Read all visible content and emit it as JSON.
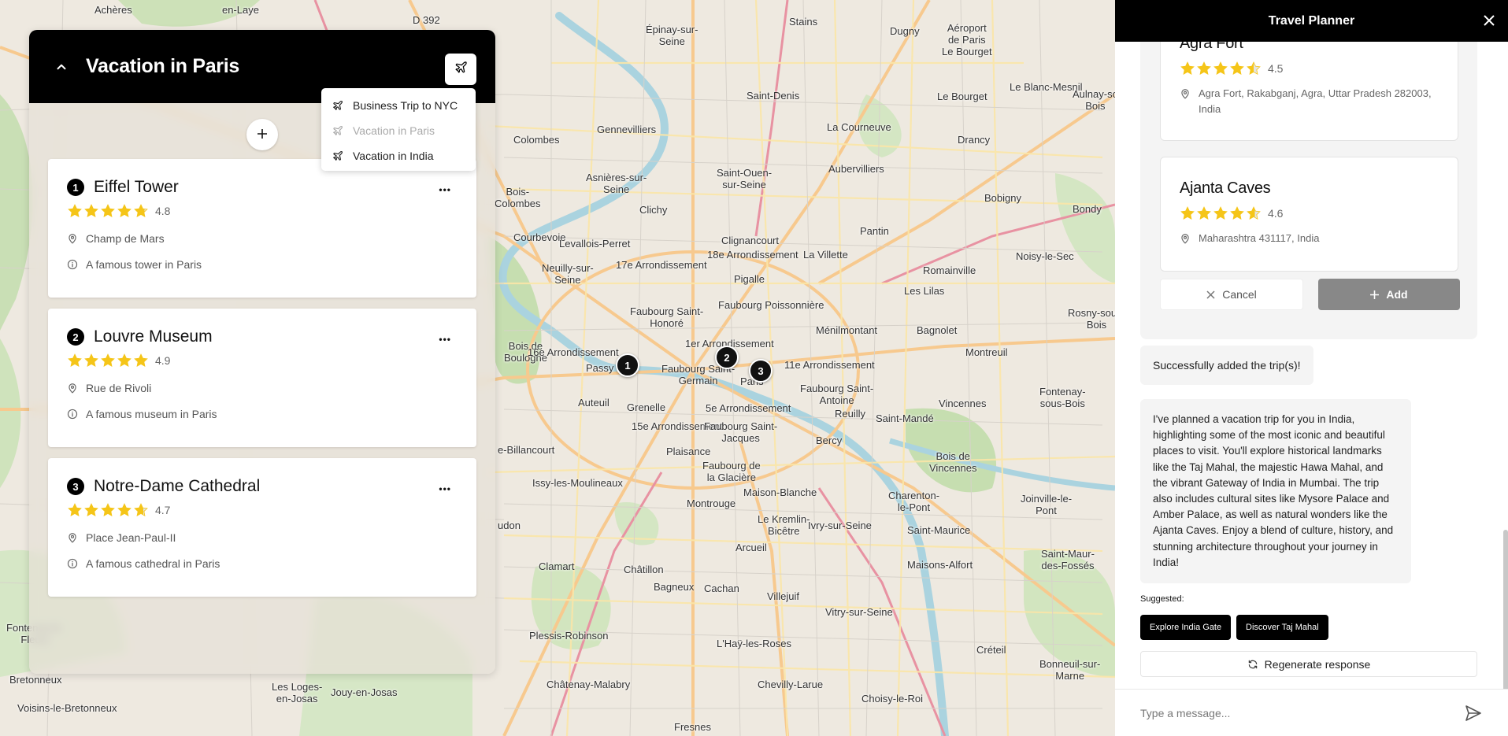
{
  "map": {
    "labels": [
      {
        "text": "Achères",
        "l": 120,
        "t": 5
      },
      {
        "text": "en-Laye",
        "l": 282,
        "t": 5
      },
      {
        "text": "D 392",
        "l": 524,
        "t": 18
      },
      {
        "text": "Épinay-sur-\nSeine",
        "l": 820,
        "t": 30
      },
      {
        "text": "Stains",
        "l": 1002,
        "t": 20
      },
      {
        "text": "Dugny",
        "l": 1130,
        "t": 32
      },
      {
        "text": "Aéroport\nde Paris\nLe Bourget",
        "l": 1196,
        "t": 28
      },
      {
        "text": "Gennevilliers",
        "l": 758,
        "t": 157
      },
      {
        "text": "Saint-Denis",
        "l": 948,
        "t": 114
      },
      {
        "text": "Le Bourget",
        "l": 1190,
        "t": 115
      },
      {
        "text": "Le Blanc-Mesnil",
        "l": 1282,
        "t": 103
      },
      {
        "text": "Aulnay-so\nBois",
        "l": 1362,
        "t": 112
      },
      {
        "text": "La Courneuve",
        "l": 1050,
        "t": 154
      },
      {
        "text": "Colombes",
        "l": 652,
        "t": 170
      },
      {
        "text": "Drancy",
        "l": 1216,
        "t": 170
      },
      {
        "text": "Asnières-sur-\nSeine",
        "l": 744,
        "t": 218
      },
      {
        "text": "Saint-Ouen-\nsur-Seine",
        "l": 910,
        "t": 212
      },
      {
        "text": "Aubervilliers",
        "l": 1052,
        "t": 207
      },
      {
        "text": "Bobigny",
        "l": 1250,
        "t": 244
      },
      {
        "text": "Bondy",
        "l": 1362,
        "t": 258
      },
      {
        "text": "Bois-\nColombes",
        "l": 628,
        "t": 236
      },
      {
        "text": "Clichy",
        "l": 812,
        "t": 259
      },
      {
        "text": "Courbevoie",
        "l": 652,
        "t": 294
      },
      {
        "text": "Levallois-Perret",
        "l": 710,
        "t": 302
      },
      {
        "text": "Clignancourt",
        "l": 916,
        "t": 298
      },
      {
        "text": "Pantin",
        "l": 1092,
        "t": 286
      },
      {
        "text": "Neuilly-sur-\nSeine",
        "l": 688,
        "t": 333
      },
      {
        "text": "17e Arrondissement",
        "l": 782,
        "t": 329
      },
      {
        "text": "18e Arrondissement",
        "l": 898,
        "t": 316
      },
      {
        "text": "La Villette",
        "l": 1020,
        "t": 316
      },
      {
        "text": "Noisy-le-Sec",
        "l": 1290,
        "t": 318
      },
      {
        "text": "Romainville",
        "l": 1172,
        "t": 336
      },
      {
        "text": "Pigalle",
        "l": 932,
        "t": 347
      },
      {
        "text": "Les Lilas",
        "l": 1148,
        "t": 362
      },
      {
        "text": "Faubourg Saint-\nHonoré",
        "l": 800,
        "t": 388
      },
      {
        "text": "Faubourg Poissonnière",
        "l": 912,
        "t": 380
      },
      {
        "text": "Rosny-sous-\nBois",
        "l": 1356,
        "t": 390
      },
      {
        "text": "Ménilmontant",
        "l": 1036,
        "t": 412
      },
      {
        "text": "Bagnolet",
        "l": 1164,
        "t": 412
      },
      {
        "text": "Bois de\nBoulogne",
        "l": 640,
        "t": 432
      },
      {
        "text": "16e Arrondissement",
        "l": 670,
        "t": 440
      },
      {
        "text": "1er Arrondissement",
        "l": 870,
        "t": 429
      },
      {
        "text": "Montreuil",
        "l": 1226,
        "t": 440
      },
      {
        "text": "Passy",
        "l": 744,
        "t": 460
      },
      {
        "text": "Faubourg Saint-\nGermain",
        "l": 840,
        "t": 461
      },
      {
        "text": "Paris",
        "l": 940,
        "t": 477
      },
      {
        "text": "11e Arrondissement",
        "l": 996,
        "t": 456
      },
      {
        "text": "Faubourg Saint-\nAntoine",
        "l": 1016,
        "t": 486
      },
      {
        "text": "Vincennes",
        "l": 1192,
        "t": 505
      },
      {
        "text": "Fontenay-\nsous-Bois",
        "l": 1320,
        "t": 490
      },
      {
        "text": "Auteuil",
        "l": 734,
        "t": 504
      },
      {
        "text": "Grenelle",
        "l": 796,
        "t": 510
      },
      {
        "text": "5e Arrondissement",
        "l": 896,
        "t": 511
      },
      {
        "text": "Reuilly",
        "l": 1060,
        "t": 518
      },
      {
        "text": "Saint-Mandé",
        "l": 1112,
        "t": 524
      },
      {
        "text": "15e Arrondissement",
        "l": 802,
        "t": 534
      },
      {
        "text": "Faubourg Saint-\nJacques",
        "l": 894,
        "t": 534
      },
      {
        "text": "Bercy",
        "l": 1036,
        "t": 552
      },
      {
        "text": "Bois de\nVincennes",
        "l": 1180,
        "t": 572
      },
      {
        "text": "e-Billancourt",
        "l": 632,
        "t": 564
      },
      {
        "text": "Plaisance",
        "l": 846,
        "t": 566
      },
      {
        "text": "Faubourg de\nla Glacière",
        "l": 892,
        "t": 584
      },
      {
        "text": "Issy-les-Moulineaux",
        "l": 676,
        "t": 606
      },
      {
        "text": "Maison-Blanche",
        "l": 944,
        "t": 618
      },
      {
        "text": "Charenton-\nle-Pont",
        "l": 1128,
        "t": 622
      },
      {
        "text": "Joinville-le-\nPont",
        "l": 1296,
        "t": 626
      },
      {
        "text": "Montrouge",
        "l": 872,
        "t": 632
      },
      {
        "text": "Le Kremlin-\nBicêtre",
        "l": 962,
        "t": 652
      },
      {
        "text": "Ivry-sur-Seine",
        "l": 1026,
        "t": 660
      },
      {
        "text": "Saint-Maurice",
        "l": 1152,
        "t": 666
      },
      {
        "text": "udon",
        "l": 632,
        "t": 660
      },
      {
        "text": "Arcueil",
        "l": 934,
        "t": 688
      },
      {
        "text": "Clamart",
        "l": 684,
        "t": 712
      },
      {
        "text": "Châtillon",
        "l": 792,
        "t": 716
      },
      {
        "text": "Maisons-Alfort",
        "l": 1152,
        "t": 710
      },
      {
        "text": "Saint-Maur-\ndes-Fossés",
        "l": 1322,
        "t": 696
      },
      {
        "text": "Bagneux",
        "l": 830,
        "t": 738
      },
      {
        "text": "Cachan",
        "l": 894,
        "t": 740
      },
      {
        "text": "Villejuif",
        "l": 974,
        "t": 750
      },
      {
        "text": "Vitry-sur-Seine",
        "l": 1048,
        "t": 770
      },
      {
        "text": "Plessis-Robinson",
        "l": 672,
        "t": 800
      },
      {
        "text": "L'Haÿ-les-Roses",
        "l": 910,
        "t": 810
      },
      {
        "text": "Créteil",
        "l": 1240,
        "t": 818
      },
      {
        "text": "Châtenay-Malabry",
        "l": 694,
        "t": 862
      },
      {
        "text": "Chevilly-Larue",
        "l": 962,
        "t": 862
      },
      {
        "text": "Choisy-le-Roi",
        "l": 1094,
        "t": 880
      },
      {
        "text": "Bonneuil-sur-\nMarne",
        "l": 1320,
        "t": 836
      },
      {
        "text": "Fresnes",
        "l": 856,
        "t": 916
      },
      {
        "text": "Jouy-en-Josas",
        "l": 420,
        "t": 872
      },
      {
        "text": "Les Loges-\nen-Josas",
        "l": 345,
        "t": 865
      },
      {
        "text": "Bretonneux",
        "l": 12,
        "t": 856
      },
      {
        "text": "Voisins-le-Bretonneux",
        "l": 22,
        "t": 892
      },
      {
        "text": "Fontenay-le-\nFleury",
        "l": 8,
        "t": 790
      }
    ],
    "markers": [
      {
        "label": "1",
        "l": 782,
        "t": 449
      },
      {
        "label": "2",
        "l": 908,
        "t": 439
      },
      {
        "label": "3",
        "l": 951,
        "t": 456
      }
    ]
  },
  "trip_panel": {
    "title": "Vacation in Paris",
    "collapse_icon": "chevron-up-icon",
    "switch_icon": "plane-icon",
    "add_icon": "plus-icon",
    "places": [
      {
        "num": "1",
        "name": "Eiffel Tower",
        "rating": 4.8,
        "rating_text": "4.8",
        "address": "Champ de Mars",
        "description": "A famous tower in Paris"
      },
      {
        "num": "2",
        "name": "Louvre Museum",
        "rating": 4.9,
        "rating_text": "4.9",
        "address": "Rue de Rivoli",
        "description": "A famous museum in Paris"
      },
      {
        "num": "3",
        "name": "Notre-Dame Cathedral",
        "rating": 4.7,
        "rating_text": "4.7",
        "address": "Place Jean-Paul-II",
        "description": "A famous cathedral in Paris"
      }
    ],
    "menu": [
      {
        "label": "Business Trip to NYC",
        "disabled": false
      },
      {
        "label": "Vacation in Paris",
        "disabled": true
      },
      {
        "label": "Vacation in India",
        "disabled": false
      }
    ]
  },
  "chat": {
    "title": "Travel Planner",
    "results": [
      {
        "name": "Agra Fort",
        "rating": 4.5,
        "rating_text": "4.5",
        "address": "Agra Fort, Rakabganj, Agra, Uttar Pradesh 282003, India"
      },
      {
        "name": "Ajanta Caves",
        "rating": 4.6,
        "rating_text": "4.6",
        "address": "Maharashtra 431117, India"
      }
    ],
    "cancel_label": "Cancel",
    "add_label": "Add",
    "success_message": "Successfully added the trip(s)!",
    "plan_message": "I've planned a vacation trip for you in India, highlighting some of the most iconic and beautiful places to visit. You'll explore historical landmarks like the Taj Mahal, the majestic Hawa Mahal, and the vibrant Gateway of India in Mumbai. The trip also includes cultural sites like Mysore Palace and Amber Palace, as well as natural wonders like the Ajanta Caves. Enjoy a blend of culture, history, and stunning architecture throughout your journey in India!",
    "suggested_label": "Suggested:",
    "suggestions": [
      "Explore India Gate",
      "Discover Taj Mahal"
    ],
    "regenerate_label": "Regenerate response",
    "input_placeholder": "Type a message...",
    "star_color": "#f5c518"
  }
}
